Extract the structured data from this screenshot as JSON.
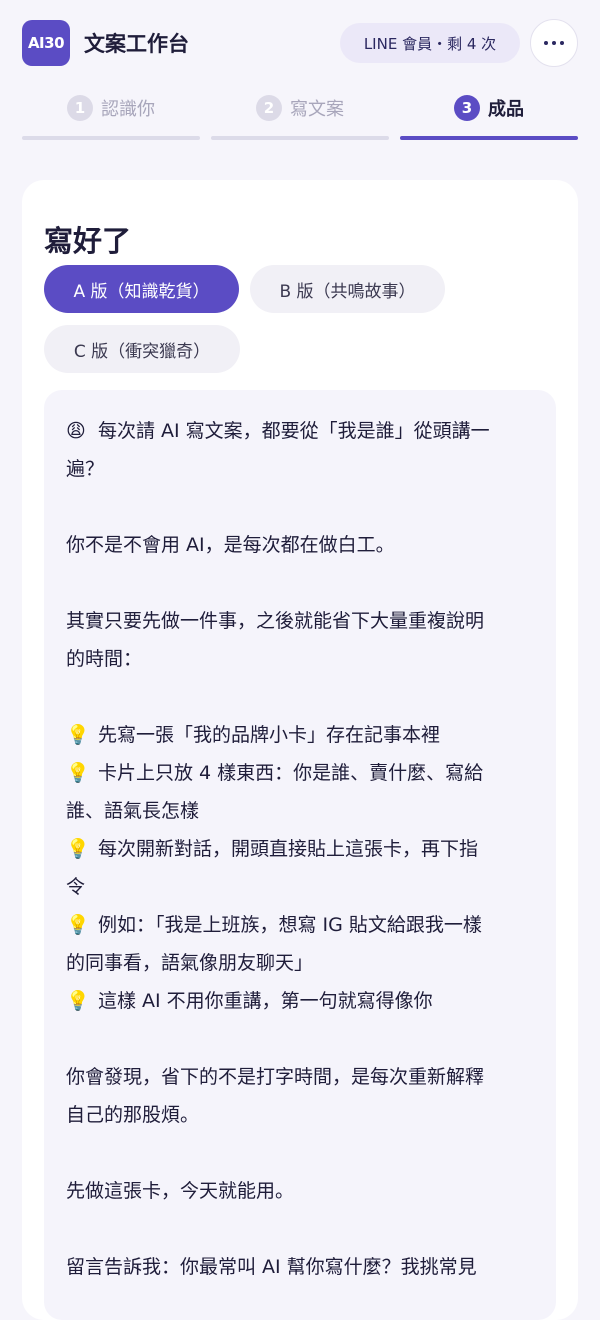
{
  "header": {
    "logo_text": "AI30",
    "title": "文案工作台",
    "member_badge": "LINE 會員・剩 4 次",
    "more_icon": "more-horizontal-icon"
  },
  "steps": [
    {
      "number": "1",
      "label": "認識你",
      "active": false
    },
    {
      "number": "2",
      "label": "寫文案",
      "active": false
    },
    {
      "number": "3",
      "label": "成品",
      "active": true
    }
  ],
  "result": {
    "title": "寫好了",
    "versions": [
      {
        "label": "A 版（知識乾貨）",
        "active": true
      },
      {
        "label": "B 版（共鳴故事）",
        "active": false
      },
      {
        "label": "C 版（衝突獵奇）",
        "active": false
      }
    ],
    "lines": [
      {
        "emoji": "😩",
        "text": "每次請 AI 寫文案，都要從「我是誰」從頭講一"
      },
      {
        "emoji": "",
        "text": "遍？"
      },
      {
        "emoji": "",
        "text": ""
      },
      {
        "emoji": "",
        "text": "你不是不會用 AI，是每次都在做白工。"
      },
      {
        "emoji": "",
        "text": ""
      },
      {
        "emoji": "",
        "text": "其實只要先做一件事，之後就能省下大量重複說明"
      },
      {
        "emoji": "",
        "text": "的時間："
      },
      {
        "emoji": "",
        "text": ""
      },
      {
        "emoji": "💡",
        "text": "先寫一張「我的品牌小卡」存在記事本裡"
      },
      {
        "emoji": "💡",
        "text": "卡片上只放 4 樣東西：你是誰、賣什麼、寫給"
      },
      {
        "emoji": "",
        "text": "誰、語氣長怎樣"
      },
      {
        "emoji": "💡",
        "text": "每次開新對話，開頭直接貼上這張卡，再下指"
      },
      {
        "emoji": "",
        "text": "令"
      },
      {
        "emoji": "💡",
        "text": "例如：「我是上班族，想寫 IG 貼文給跟我一樣"
      },
      {
        "emoji": "",
        "text": "的同事看，語氣像朋友聊天」"
      },
      {
        "emoji": "💡",
        "text": "這樣 AI 不用你重講，第一句就寫得像你"
      },
      {
        "emoji": "",
        "text": ""
      },
      {
        "emoji": "",
        "text": "你會發現，省下的不是打字時間，是每次重新解釋"
      },
      {
        "emoji": "",
        "text": "自己的那股煩。"
      },
      {
        "emoji": "",
        "text": ""
      },
      {
        "emoji": "",
        "text": "先做這張卡，今天就能用。"
      },
      {
        "emoji": "",
        "text": ""
      },
      {
        "emoji": "",
        "text": "留言告訴我：你最常叫 AI 幫你寫什麼？我挑常見"
      }
    ]
  }
}
